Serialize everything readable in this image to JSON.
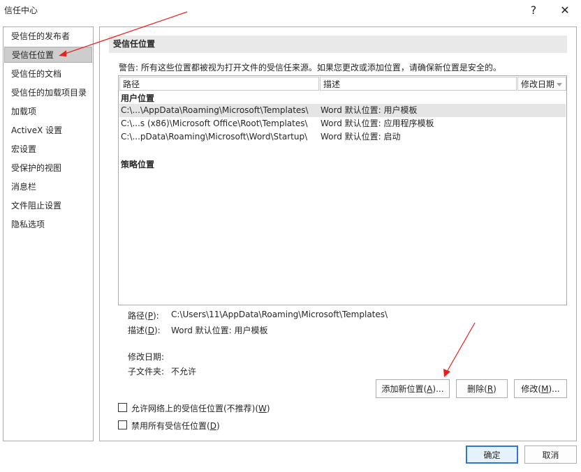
{
  "window": {
    "title": "信任中心",
    "help_glyph": "?",
    "close_glyph": "✕"
  },
  "sidebar": {
    "items": [
      {
        "label": "受信任的发布者"
      },
      {
        "label": "受信任位置",
        "selected": true
      },
      {
        "label": "受信任的文档"
      },
      {
        "label": "受信任的加载项目录"
      },
      {
        "label": "加载项"
      },
      {
        "label": "ActiveX 设置"
      },
      {
        "label": "宏设置"
      },
      {
        "label": "受保护的视图"
      },
      {
        "label": "消息栏"
      },
      {
        "label": "文件阻止设置"
      },
      {
        "label": "隐私选项"
      }
    ]
  },
  "main": {
    "section_title": "受信任位置",
    "warning": "警告: 所有这些位置都被视为打开文件的受信任来源。如果您更改或添加位置，请确保新位置是安全的。",
    "columns": {
      "path": "路径",
      "description": "描述",
      "modified": "修改日期"
    },
    "user_group": "用户位置",
    "policy_group": "策略位置",
    "rows": [
      {
        "path": "C:\\...\\AppData\\Roaming\\Microsoft\\Templates\\",
        "description": "Word 默认位置: 用户模板",
        "selected": true
      },
      {
        "path": "C:\\...s (x86)\\Microsoft Office\\Root\\Templates\\",
        "description": "Word 默认位置: 应用程序模板"
      },
      {
        "path": "C:\\...pData\\Roaming\\Microsoft\\Word\\Startup\\",
        "description": "Word 默认位置: 启动"
      }
    ],
    "details": {
      "path_label": "路径(",
      "path_key": "P",
      "path_value": "C:\\Users\\11\\AppData\\Roaming\\Microsoft\\Templates\\",
      "desc_label": "描述(",
      "desc_key": "D",
      "desc_value": "Word 默认位置: 用户模板",
      "modified_label": "修改日期:",
      "subfolder_label": "子文件夹:",
      "subfolder_value": "不允许"
    },
    "buttons": {
      "add_prefix": "添加新位置(",
      "add_key": "A",
      "add_suffix": ")...",
      "remove_prefix": "删除(",
      "remove_key": "R",
      "modify_prefix": "修改(",
      "modify_key": "M",
      "modify_suffix": ")..."
    },
    "checkboxes": {
      "network_prefix": "允许网络上的受信任位置(不推荐)(",
      "network_key": "W",
      "network_checked": false,
      "disable_prefix": "禁用所有受信任位置(",
      "disable_key": "D",
      "disable_checked": false
    }
  },
  "footer": {
    "ok": "确定",
    "cancel": "取消"
  },
  "annotations": {
    "arrow_color": "#e8201c"
  }
}
